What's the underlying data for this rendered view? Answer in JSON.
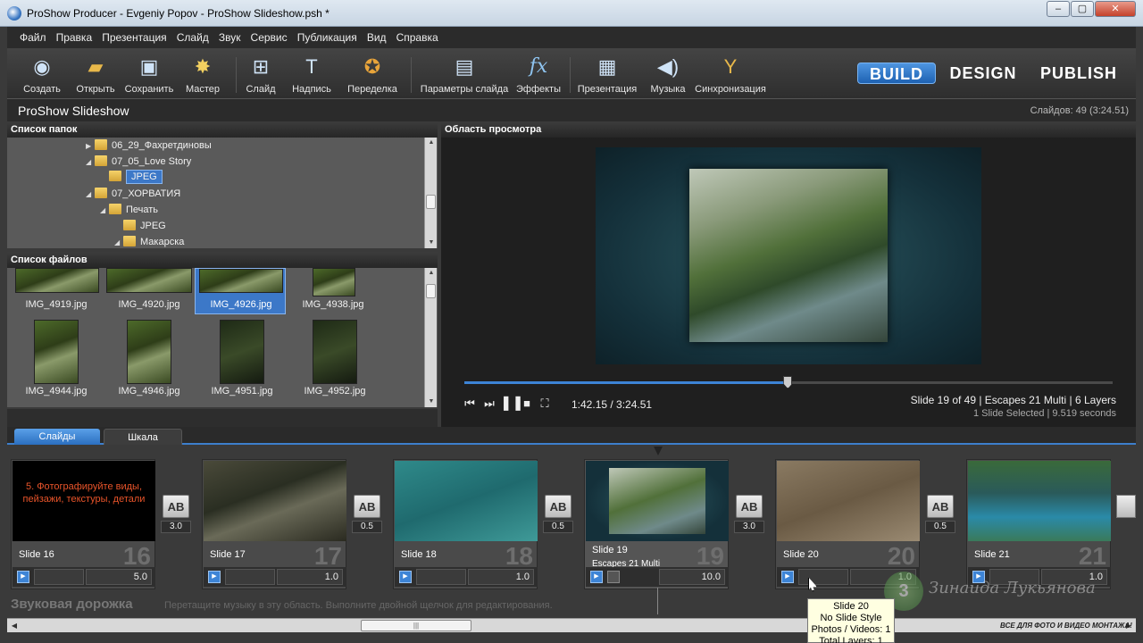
{
  "window": {
    "title": "ProShow Producer - Evgeniy Popov - ProShow Slideshow.psh *",
    "controls": {
      "minimize": "–",
      "maximize": "▢",
      "close": "✕"
    }
  },
  "menu": [
    "Файл",
    "Правка",
    "Презентация",
    "Слайд",
    "Звук",
    "Сервис",
    "Публикация",
    "Вид",
    "Справка"
  ],
  "toolbar": {
    "tools": [
      {
        "label": "Создать",
        "icon": "create-icon",
        "glyph": "◉"
      },
      {
        "label": "Открыть",
        "icon": "open-folder-icon",
        "glyph": "▰"
      },
      {
        "label": "Сохранить",
        "icon": "save-disk-icon",
        "glyph": "▣"
      },
      {
        "label": "Мастер",
        "icon": "wizard-icon",
        "glyph": "✸"
      },
      {
        "label": "Слайд",
        "icon": "add-slide-icon",
        "glyph": "⊞"
      },
      {
        "label": "Надпись",
        "icon": "caption-icon",
        "glyph": "T"
      },
      {
        "label": "Переделка",
        "icon": "remix-icon",
        "glyph": "✪"
      },
      {
        "label": "Параметры слайда",
        "icon": "slide-options-icon",
        "glyph": "▤"
      },
      {
        "label": "Эффекты",
        "icon": "effects-fx-icon",
        "glyph": "fx"
      },
      {
        "label": "Презентация",
        "icon": "show-options-icon",
        "glyph": "▦"
      },
      {
        "label": "Музыка",
        "icon": "music-speaker-icon",
        "glyph": "◀)"
      },
      {
        "label": "Синхронизация",
        "icon": "sync-icon",
        "glyph": "Y"
      }
    ],
    "modes": {
      "build": "BUILD",
      "design": "DESIGN",
      "publish": "PUBLISH"
    }
  },
  "show": {
    "name": "ProShow Slideshow",
    "count": "Слайдов: 49 (3:24.51)"
  },
  "folders": {
    "header": "Список папок",
    "items": [
      "06_29_Фахретдиновы",
      "07_05_Love Story",
      "JPEG",
      "07_ХОРВАТИЯ",
      "Печать",
      "JPEG",
      "Макарска"
    ]
  },
  "files": {
    "header": "Список файлов",
    "items": [
      "IMG_4919.jpg",
      "IMG_4920.jpg",
      "IMG_4926.jpg",
      "IMG_4938.jpg",
      "IMG_4944.jpg",
      "IMG_4946.jpg",
      "IMG_4951.jpg",
      "IMG_4952.jpg"
    ]
  },
  "preview": {
    "header": "Область просмотра",
    "timecode": "1:42.15 / 3:24.51",
    "progress": 0.499,
    "slide_info": "Slide 19 of 49  |  Escapes 21 Multi  |  6 Layers",
    "slide_sub": "1 Slide Selected  |  9.519 seconds"
  },
  "tabs": {
    "slides": "Слайды",
    "timeline": "Шкала"
  },
  "slides": [
    {
      "name": "Slide 16",
      "sub": "",
      "num": "16",
      "dur": "5.0",
      "text": "5. Фотографируйте виды, пейзажи, текстуры, детали"
    },
    {
      "name": "Slide 17",
      "sub": "",
      "num": "17",
      "dur": "1.0",
      "text": ""
    },
    {
      "name": "Slide 18",
      "sub": "",
      "num": "18",
      "dur": "1.0",
      "text": ""
    },
    {
      "name": "Slide 19",
      "sub": "Escapes 21 Multi",
      "num": "19",
      "dur": "10.0",
      "text": ""
    },
    {
      "name": "Slide 20",
      "sub": "",
      "num": "20",
      "dur": "1.0",
      "text": ""
    },
    {
      "name": "Slide 21",
      "sub": "",
      "num": "21",
      "dur": "1.0",
      "text": ""
    }
  ],
  "transitions": [
    {
      "label": "AB",
      "dur": "3.0"
    },
    {
      "label": "AB",
      "dur": "0.5"
    },
    {
      "label": "AB",
      "dur": "0.5"
    },
    {
      "label": "AB",
      "dur": "3.0"
    },
    {
      "label": "AB",
      "dur": "0.5"
    }
  ],
  "soundtrack": {
    "title": "Звуковая дорожка",
    "hint": "Перетащите музыку в эту область. Выполните двойной щелчок для редактирования."
  },
  "tooltip": [
    "Slide 20",
    "No Slide Style",
    "Photos / Videos: 1",
    "Total Layers: 1"
  ],
  "watermark": {
    "slogan": "ВСЕ ДЛЯ ФОТО И ВИДЕО МОНТАЖА!",
    "logo_letter": "3",
    "script_text": "Зинаида Лукьянова"
  },
  "colors": {
    "accent": "#3d84d6",
    "panel": "#5a5a5a",
    "dark": "#2b2b2b"
  }
}
